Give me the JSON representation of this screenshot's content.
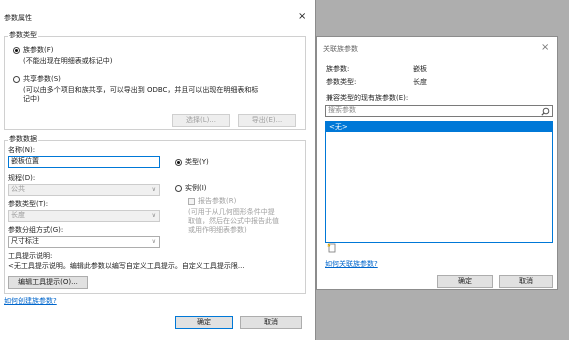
{
  "left_dialog": {
    "title": "参数属性",
    "close": "×",
    "param_type_group": "参数类型",
    "family_param": "族参数(F)",
    "family_param_desc": "(不能出现在明细表或标记中)",
    "shared_param": "共享参数(S)",
    "shared_param_desc1": "(可以由多个项目和族共享，可以导出到 ODBC，并且可以出现在明细表和标",
    "shared_param_desc2": "记中)",
    "select_btn": "选择(L)...",
    "export_btn": "导出(E)...",
    "param_data_group": "参数数据",
    "name_label": "名称(N):",
    "name_value": "嵌板位置",
    "type_radio": "类型(Y)",
    "discipline_label": "规程(D):",
    "discipline_value": "公共",
    "instance_radio": "实例(I)",
    "param_kind_label": "参数类型(T):",
    "param_kind_value": "长度",
    "report_param": "报告参数(R)",
    "report_desc1": "(可用于从几何图形条件中提",
    "report_desc2": "取值，然后在公式中报告此值",
    "report_desc3": "或用作明细表参数)",
    "group_label": "参数分组方式(G):",
    "group_value": "尺寸标注",
    "tooltip_label": "工具提示说明:",
    "tooltip_value": "<无工具提示说明。编辑此参数以编写自定义工具提示。自定义工具提示限...",
    "edit_tooltip_btn": "编辑工具提示(O)...",
    "howto_link": "如何创建族参数?",
    "ok_btn": "确定",
    "cancel_btn": "取消"
  },
  "right_dialog": {
    "title": "关联族参数",
    "close": "×",
    "family_param_label": "族参数:",
    "family_param_value": "嵌板",
    "param_type_label": "参数类型:",
    "param_type_value": "长度",
    "compatible_label": "兼容类型的现有族参数(E):",
    "search_placeholder": "搜索参数",
    "list_items": [
      "<无>"
    ],
    "new_param_icon": "new-parameter-icon",
    "howto_link": "如何关联族参数?",
    "ok_btn": "确定",
    "cancel_btn": "取消"
  },
  "colors": {
    "selection": "#0078d7",
    "link": "#0066cc",
    "backdrop": "#aeaeae"
  }
}
